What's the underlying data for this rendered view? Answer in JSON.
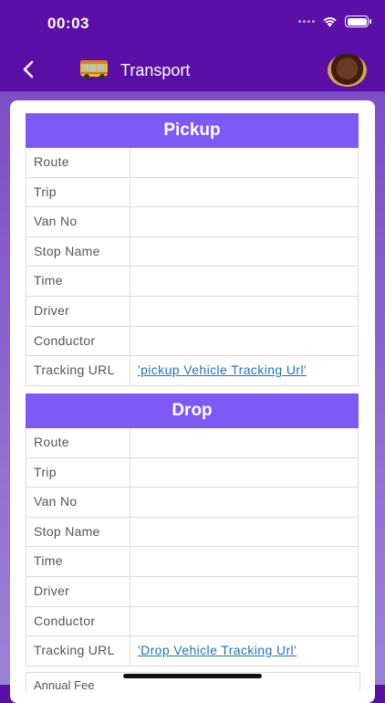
{
  "status": {
    "time": "00:03"
  },
  "header": {
    "title": "Transport"
  },
  "pickup": {
    "title": "Pickup",
    "rows": [
      {
        "label": "Route",
        "value": ""
      },
      {
        "label": "Trip",
        "value": ""
      },
      {
        "label": "Van No",
        "value": ""
      },
      {
        "label": "Stop Name",
        "value": ""
      },
      {
        "label": "Time",
        "value": ""
      },
      {
        "label": "Driver",
        "value": ""
      },
      {
        "label": "Conductor",
        "value": ""
      },
      {
        "label": "Tracking URL",
        "value": "'pickup Vehicle Tracking Url'"
      }
    ]
  },
  "drop": {
    "title": "Drop",
    "rows": [
      {
        "label": "Route",
        "value": ""
      },
      {
        "label": "Trip",
        "value": ""
      },
      {
        "label": "Van No",
        "value": ""
      },
      {
        "label": "Stop Name",
        "value": ""
      },
      {
        "label": "Time",
        "value": ""
      },
      {
        "label": "Driver",
        "value": ""
      },
      {
        "label": "Conductor",
        "value": ""
      },
      {
        "label": "Tracking URL",
        "value": "'Drop Vehicle Tracking Url'"
      }
    ]
  },
  "partial": {
    "label": "Annual Fee"
  },
  "colors": {
    "header_bar": "#5a10a6",
    "table_header": "#7e59f5",
    "link": "#1e73be"
  }
}
